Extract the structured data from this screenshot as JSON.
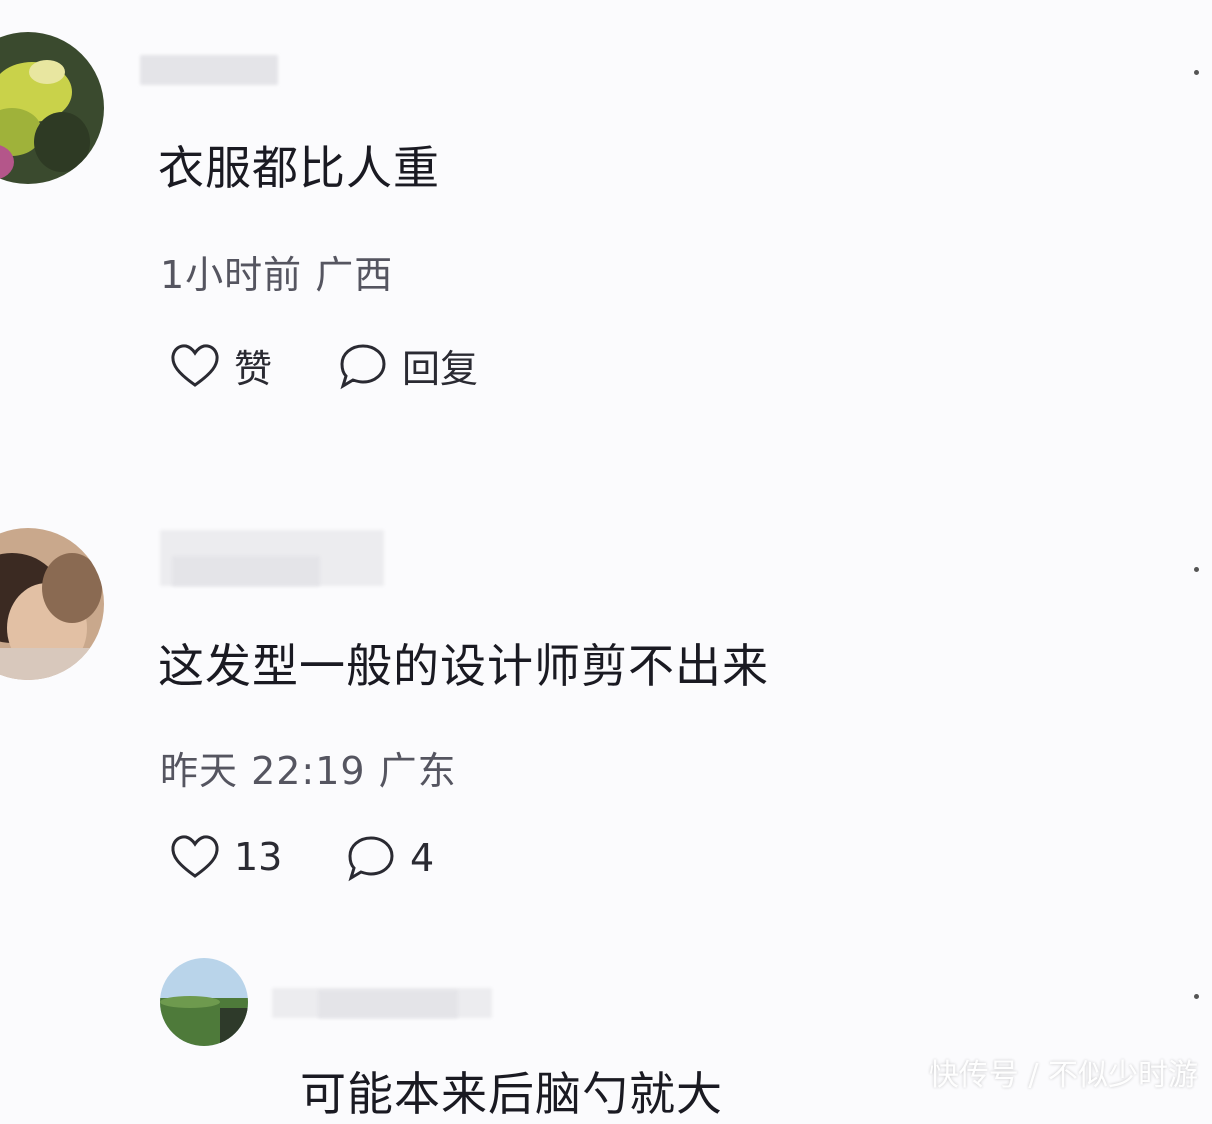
{
  "comments": [
    {
      "text": "衣服都比人重",
      "meta": "1小时前 广西",
      "like_label": "赞",
      "reply_label": "回复"
    },
    {
      "text": "这发型一般的设计师剪不出来",
      "meta": "昨天 22:19 广东",
      "like_label": "13",
      "reply_label": "4"
    },
    {
      "text": "可能本来后脑勺就大"
    }
  ],
  "watermark": "快传号 / 不似少时游",
  "icons": {
    "like": "heart-icon",
    "reply": "comment-bubble-icon",
    "more": "more-dot-icon"
  }
}
